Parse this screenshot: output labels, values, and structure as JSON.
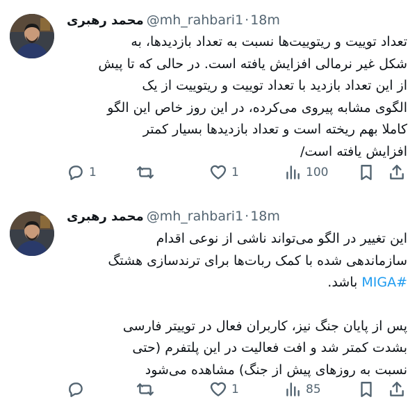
{
  "tweets": [
    {
      "author": {
        "name": "محمد رهبری",
        "handle": "@mh_rahbari1",
        "time": "18m"
      },
      "lines": [
        "تعداد توییت و ریتوییت‌ها نسبت به تعداد بازدیدها، به",
        "شکل غیر نرمالی افزایش یافته است. در حالی که تا پیش",
        "از این تعداد بازدید با تعداد توییت و ریتوییت از یک",
        "الگوی مشابه پیروی می‌کرده، در این روز خاص این الگو",
        "کاملا بهم ریخته است و تعداد بازدیدها بسیار کمتر",
        "افزایش یافته است/"
      ],
      "actions": {
        "replies": "1",
        "retweets": "",
        "likes": "1",
        "views": "100"
      }
    },
    {
      "author": {
        "name": "محمد رهبری",
        "handle": "@mh_rahbari1",
        "time": "18m"
      },
      "lines": [
        "این تغییر در الگو می‌تواند ناشی از نوعی اقدام",
        "سازماندهی شده با کمک ربات‌ها برای ترندسازی هشتگ"
      ],
      "hashtag_line": {
        "hashtag": "#MIGA",
        "suffix": " باشد."
      },
      "lines2": [
        "پس از پایان جنگ نیز، کاربران فعال در توییتر فارسی",
        "بشدت کمتر شد و افت فعالیت در این پلتفرم (حتی",
        "نسبت به روزهای پیش از جنگ) مشاهده می‌شود"
      ],
      "actions": {
        "replies": "",
        "retweets": "",
        "likes": "1",
        "views": "85"
      }
    }
  ],
  "icons": {
    "reply": "reply-icon",
    "retweet": "retweet-icon",
    "like": "heart-icon",
    "views": "views-icon",
    "bookmark": "bookmark-icon",
    "share": "share-icon"
  },
  "colors": {
    "text": "#0f1419",
    "muted": "#536471",
    "link": "#1d9bf0"
  }
}
